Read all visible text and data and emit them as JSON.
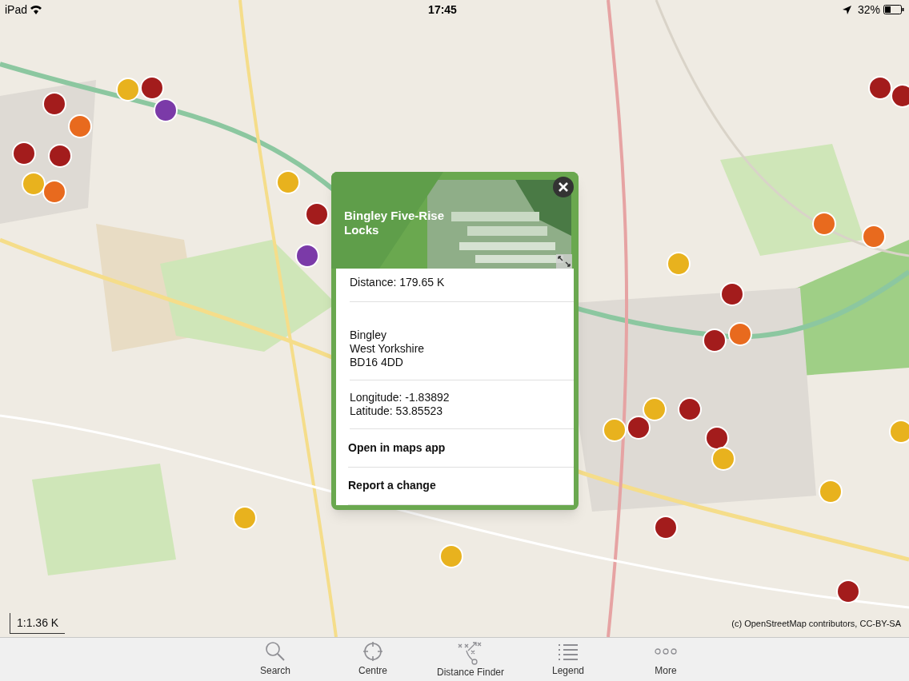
{
  "status_bar": {
    "device": "iPad",
    "time": "17:45",
    "battery": "32%"
  },
  "popup": {
    "title": "Bingley Five-Rise Locks",
    "sections": [
      {
        "kind": "info",
        "lines": [
          "Distance: 179.65 K"
        ]
      },
      {
        "kind": "info",
        "lines": [
          "Bingley",
          "West Yorkshire",
          "BD16 4DD"
        ]
      },
      {
        "kind": "info",
        "lines": [
          "Longitude: -1.83892",
          "Latitude: 53.85523"
        ]
      },
      {
        "kind": "action",
        "label": "Open in maps app"
      },
      {
        "kind": "action",
        "label": "Report a change"
      }
    ]
  },
  "scale": "1:1.36 K",
  "attribution": "(c) OpenStreetMap contributors, CC-BY-SA",
  "tab_bar": [
    {
      "label": "Search"
    },
    {
      "label": "Centre"
    },
    {
      "label": "Distance Finder"
    },
    {
      "label": "Legend"
    },
    {
      "label": "More"
    }
  ]
}
